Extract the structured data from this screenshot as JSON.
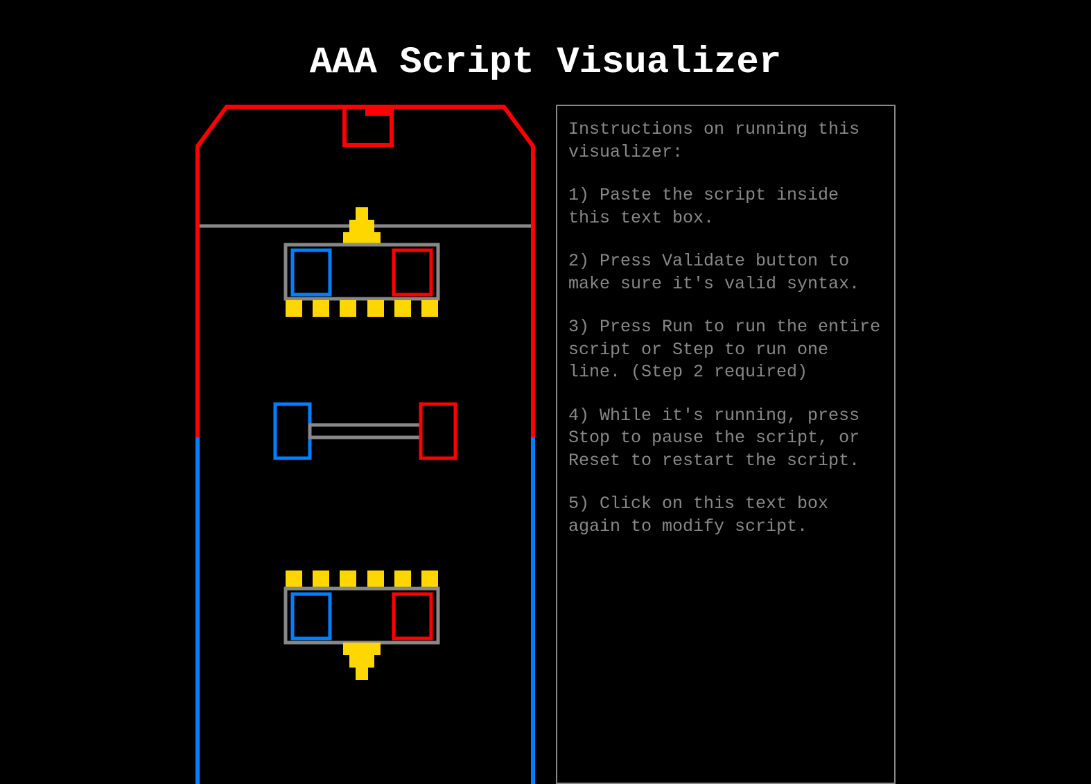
{
  "title": "AAA Script Visualizer",
  "instructions": {
    "intro": "Instructions on running this visualizer:",
    "step1": "1) Paste the script inside this text box.",
    "step2": "2) Press Validate button to make sure it's valid syntax.",
    "step3": "3) Press Run to run the entire script or Step to run one line. (Step 2 required)",
    "step4": "4) While it's running, press Stop to pause the script, or Reset to restart the script.",
    "step5": "5) Click on this text box again to modify script."
  },
  "colors": {
    "red": "#ff0000",
    "blue": "#0080ff",
    "yellow": "#ffd700",
    "gray": "#888888",
    "black": "#000000"
  }
}
